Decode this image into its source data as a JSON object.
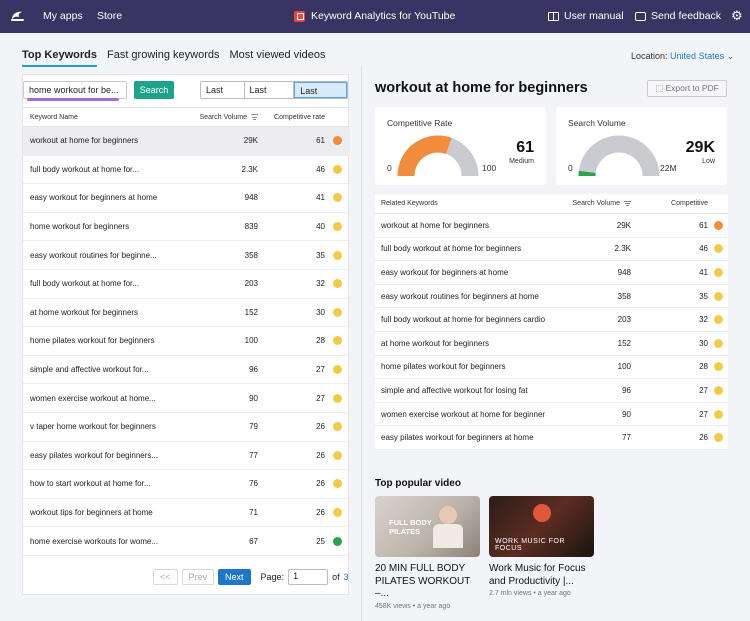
{
  "topbar": {
    "nav": [
      "My apps",
      "Store"
    ],
    "app_title": "Keyword Analytics for YouTube",
    "user_manual": "User manual",
    "send_feedback": "Send feedback"
  },
  "tabs": [
    "Top Keywords",
    "Fast growing keywords",
    "Most viewed videos"
  ],
  "location": {
    "label": "Location:",
    "value": "United States"
  },
  "search": {
    "value": "home workout for be...",
    "button": "Search"
  },
  "ranges": [
    "Last Day",
    "Last Week",
    "Last Month"
  ],
  "active_range": "Last Month",
  "table": {
    "headers": {
      "keyword": "Keyword Name",
      "volume": "Search Volume",
      "rate": "Competitive rate"
    },
    "rows": [
      {
        "keyword": "workout at home for beginners",
        "volume": "29K",
        "rate": "61",
        "color": "#f08c3c"
      },
      {
        "keyword": "full body workout at home for...",
        "volume": "2.3K",
        "rate": "46",
        "color": "#f2c94c"
      },
      {
        "keyword": "easy workout for beginners at home",
        "volume": "948",
        "rate": "41",
        "color": "#f2c94c"
      },
      {
        "keyword": "home workout for beginners",
        "volume": "839",
        "rate": "40",
        "color": "#f2c94c"
      },
      {
        "keyword": "easy workout routines for beginne...",
        "volume": "358",
        "rate": "35",
        "color": "#f2c94c"
      },
      {
        "keyword": "full body workout at home for...",
        "volume": "203",
        "rate": "32",
        "color": "#f2c94c"
      },
      {
        "keyword": "at home workout for beginners",
        "volume": "152",
        "rate": "30",
        "color": "#f2c94c"
      },
      {
        "keyword": "home pilates workout for beginners",
        "volume": "100",
        "rate": "28",
        "color": "#f2c94c"
      },
      {
        "keyword": "simple and affective workout for...",
        "volume": "96",
        "rate": "27",
        "color": "#f2c94c"
      },
      {
        "keyword": "women exercise workout at home...",
        "volume": "90",
        "rate": "27",
        "color": "#f2c94c"
      },
      {
        "keyword": "v taper home workout for beginners",
        "volume": "79",
        "rate": "26",
        "color": "#f2c94c"
      },
      {
        "keyword": "easy pilates workout for beginners...",
        "volume": "77",
        "rate": "26",
        "color": "#f2c94c"
      },
      {
        "keyword": "how to start workout at home for...",
        "volume": "76",
        "rate": "26",
        "color": "#f2c94c"
      },
      {
        "keyword": "workout tips for beginners at home",
        "volume": "71",
        "rate": "26",
        "color": "#f2c94c"
      },
      {
        "keyword": "home exercise workouts for wome...",
        "volume": "67",
        "rate": "25",
        "color": "#2e9f4f"
      }
    ]
  },
  "pager": {
    "first": "<<",
    "prev": "Prev",
    "next": "Next",
    "page_label": "Page:",
    "page": "1",
    "of": "of",
    "total": "3"
  },
  "detail": {
    "title": "workout at home for beginners",
    "export": "Export to PDF",
    "competitive": {
      "label": "Competitive Rate",
      "value": "61",
      "level": "Medium",
      "min": "0",
      "max": "100",
      "fill": 0.61,
      "color": "#f08c3c"
    },
    "volume": {
      "label": "Search Volume",
      "value": "29K",
      "level": "Low",
      "min": "0",
      "max": "22M",
      "fill": 0.04,
      "color": "#2e9f4f"
    },
    "related": {
      "headers": {
        "keyword": "Related Keywords",
        "volume": "Search Volume",
        "rate": "Competitive"
      },
      "rows": [
        {
          "keyword": "workout at home for beginners",
          "volume": "29K",
          "rate": "61",
          "color": "#f08c3c"
        },
        {
          "keyword": "full body workout at home for beginners",
          "volume": "2.3K",
          "rate": "46",
          "color": "#f2c94c"
        },
        {
          "keyword": "easy workout for beginners at home",
          "volume": "948",
          "rate": "41",
          "color": "#f2c94c"
        },
        {
          "keyword": "easy workout routines for beginners at home",
          "volume": "358",
          "rate": "35",
          "color": "#f2c94c"
        },
        {
          "keyword": "full body workout at home for beginners cardio",
          "volume": "203",
          "rate": "32",
          "color": "#f2c94c"
        },
        {
          "keyword": "at home workout for beginners",
          "volume": "152",
          "rate": "30",
          "color": "#f2c94c"
        },
        {
          "keyword": "home pilates workout for beginners",
          "volume": "100",
          "rate": "28",
          "color": "#f2c94c"
        },
        {
          "keyword": "simple and affective workout for losing fat",
          "volume": "96",
          "rate": "27",
          "color": "#f2c94c"
        },
        {
          "keyword": "women exercise workout at home for beginners",
          "volume": "90",
          "rate": "27",
          "color": "#f2c94c"
        },
        {
          "keyword": "easy pilates workout for beginners at home",
          "volume": "77",
          "rate": "26",
          "color": "#f2c94c"
        }
      ]
    }
  },
  "popular": {
    "title": "Top popular video",
    "videos": [
      {
        "title": "20 MIN FULL BODY PILATES WORKOUT –...",
        "meta": "458K views • a year ago",
        "thumb_text": "FULL BODY PILATES"
      },
      {
        "title": "Work Music for Focus and Productivity |...",
        "meta": "2.7 mln views • a year ago",
        "thumb_text": "WORK MUSIC FOR FOCUS"
      }
    ]
  }
}
